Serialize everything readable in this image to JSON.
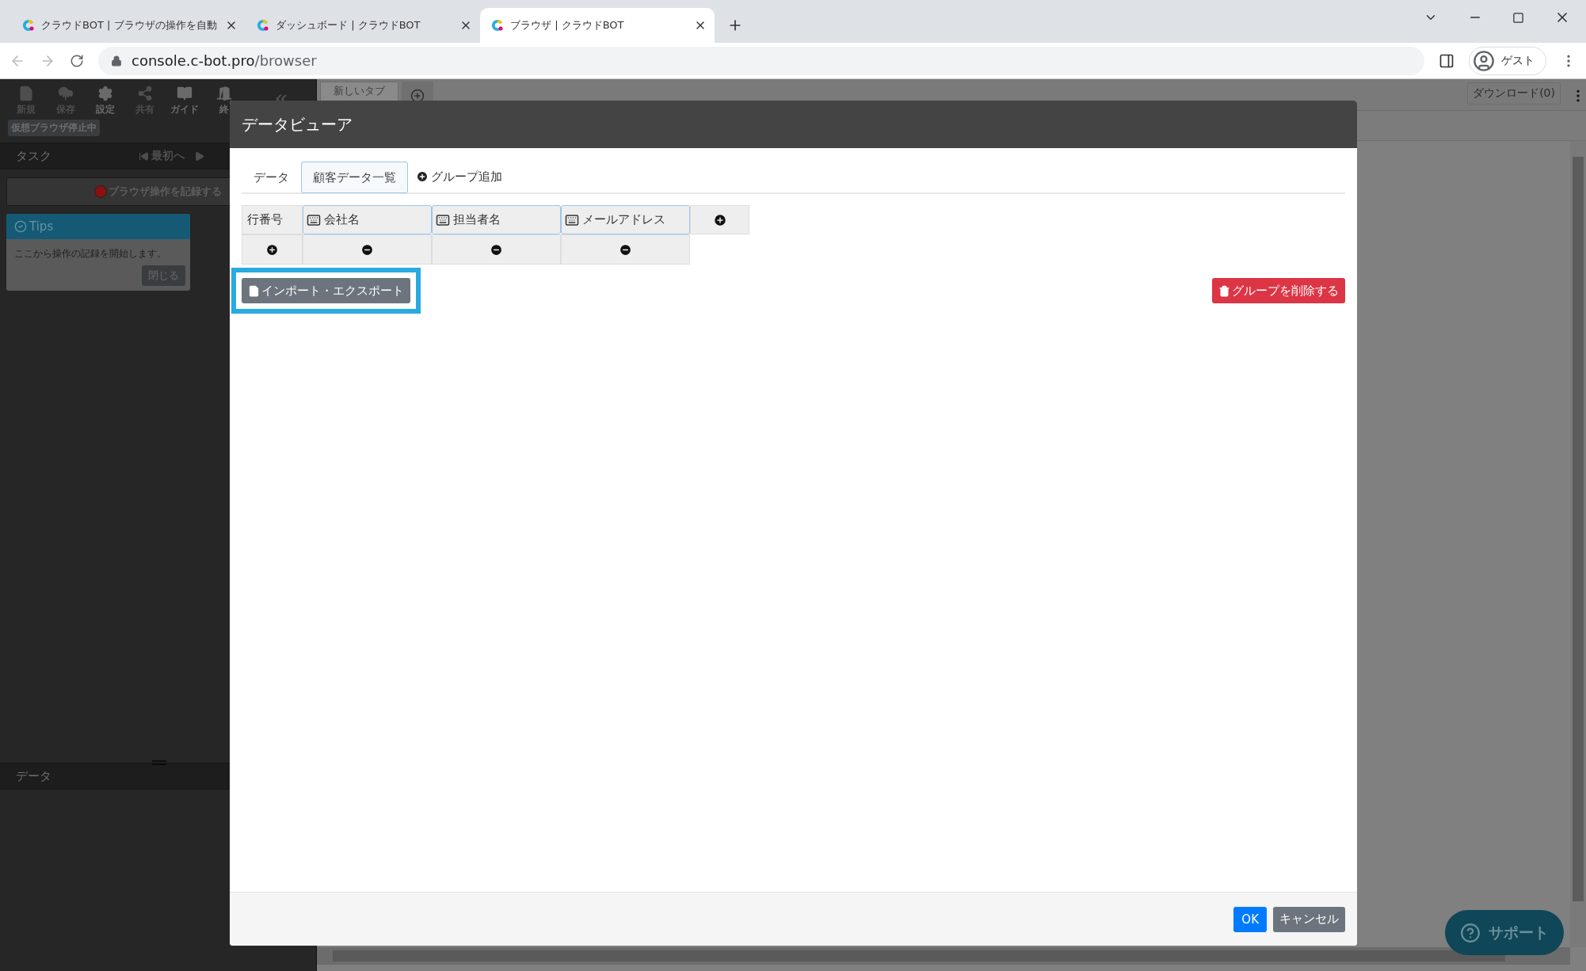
{
  "browser": {
    "tabs": [
      {
        "title": "クラウドBOT | ブラウザの操作を自動",
        "selected": false
      },
      {
        "title": "ダッシュボード | クラウドBOT",
        "selected": false
      },
      {
        "title": "ブラウザ | クラウドBOT",
        "selected": true
      }
    ],
    "url": {
      "host": "console.c-bot.pro",
      "path": "/browser"
    },
    "profile": "ゲスト"
  },
  "toolbar": {
    "items": [
      {
        "label": "新規",
        "disabled": true
      },
      {
        "label": "保存",
        "disabled": true
      },
      {
        "label": "設定",
        "disabled": false
      },
      {
        "label": "共有",
        "disabled": true
      },
      {
        "label": "ガイド",
        "disabled": false
      },
      {
        "label": "終",
        "disabled": false
      }
    ],
    "status": "仮想ブラウザ停止中"
  },
  "task_panel": {
    "title": "タスク",
    "nav": [
      "最初へ"
    ],
    "record_button": "ブラウザ操作を記録する",
    "tips": {
      "title": "Tips",
      "text": "ここから操作の記録を開始します。",
      "close": "閉じる"
    }
  },
  "data_panel": {
    "title": "データ"
  },
  "page_tabs": [
    {
      "label": "新しいタブ"
    }
  ],
  "download": "ダウンロード(0)",
  "modal": {
    "title": "データビューア",
    "tabs": [
      {
        "label": "データ",
        "selected": false
      },
      {
        "label": "顧客データ一覧",
        "selected": true
      }
    ],
    "add_group": "グループ追加",
    "table": {
      "row_header": "行番号",
      "columns": [
        "会社名",
        "担当者名",
        "メールアドレス"
      ]
    },
    "import_export": {
      "label": "インポート・エクスポート",
      "highlighted": true
    },
    "delete_group": "グループを削除する",
    "ok": "OK",
    "cancel": "キャンセル"
  },
  "support": "サポート"
}
